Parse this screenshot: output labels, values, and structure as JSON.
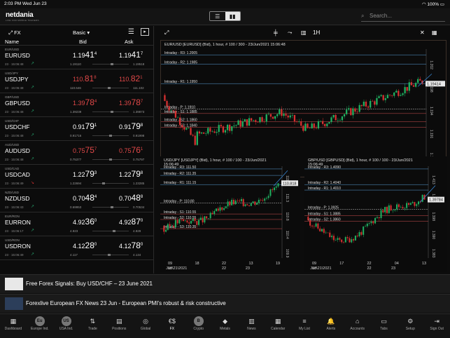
{
  "status": {
    "time": "2:03 PM",
    "date": "Wed Jun 23",
    "battery": "100%"
  },
  "header": {
    "logo": "netdania",
    "logo_sub": "LIVE FOR MOBILE TRADERS",
    "search_placeholder": "Search..."
  },
  "left": {
    "fx": "FX",
    "view": "Basic ▾",
    "cols": {
      "name": "Name",
      "bid": "Bid",
      "ask": "Ask"
    },
    "rows": [
      {
        "code": "EUR/USD",
        "sym": "EURUSD",
        "time": "23 · 15:06:48",
        "bid_a": "1.19",
        "bid_b": "41",
        "bid_c": "4",
        "ask_a": "1.19",
        "ask_b": "41",
        "ask_c": "7",
        "bid_sm": "1.19110",
        "ask_sm": "1.19518",
        "red": false,
        "spark_up": true,
        "pos": 0.55
      },
      {
        "code": "USD/JPY",
        "sym": "USDJPY",
        "time": "23 · 15:06:48",
        "bid_a": "110.",
        "bid_b": "81",
        "bid_c": "8",
        "ask_a": "110.",
        "ask_b": "82",
        "ask_c": "1",
        "bid_sm": "110.646",
        "ask_sm": "111.102",
        "red": true,
        "spark_up": true,
        "pos": 0.45
      },
      {
        "code": "GBP/USD",
        "sym": "GBPUSD",
        "time": "23 · 15:06:48",
        "bid_a": "1.39",
        "bid_b": "78",
        "bid_c": "4",
        "ask_a": "1.39",
        "ask_b": "78",
        "ask_c": "7",
        "bid_sm": "1.39239",
        "ask_sm": "1.39873",
        "red": true,
        "spark_up": true,
        "pos": 0.55
      },
      {
        "code": "USD/CHF",
        "sym": "USDCHF",
        "time": "23 · 15:06:48",
        "bid_a": "0.91",
        "bid_b": "79",
        "bid_c": "1",
        "ask_a": "0.91",
        "ask_b": "79",
        "ask_c": "8",
        "bid_sm": "0.91716",
        "ask_sm": "0.91998",
        "red": false,
        "spark_up": true,
        "pos": 0.5
      },
      {
        "code": "AUD/USD",
        "sym": "AUDUSD",
        "time": "23 · 15:06:48",
        "bid_a": "0.75",
        "bid_b": "75",
        "bid_c": "7",
        "ask_a": "0.75",
        "ask_b": "76",
        "ask_c": "1",
        "bid_sm": "0.75377",
        "ask_sm": "0.75797",
        "red": true,
        "spark_up": true,
        "pos": 0.5
      },
      {
        "code": "USD/CAD",
        "sym": "USDCAD",
        "time": "23 · 15:06:49",
        "bid_a": "1.22",
        "bid_b": "79",
        "bid_c": "3",
        "ask_a": "1.22",
        "ask_b": "79",
        "ask_c": "8",
        "bid_sm": "1.22694",
        "ask_sm": "1.23285",
        "red": false,
        "spark_up": false,
        "pos": 0.3
      },
      {
        "code": "NZD/USD",
        "sym": "NZDUSD",
        "time": "23 · 15:06:43",
        "bid_a": "0.70",
        "bid_b": "48",
        "bid_c": "4",
        "ask_a": "0.70",
        "ask_b": "48",
        "ask_c": "8",
        "bid_sm": "0.69953",
        "ask_sm": "0.70534",
        "red": false,
        "spark_up": true,
        "pos": 0.55
      },
      {
        "code": "EUR/RON",
        "sym": "EURRON",
        "time": "23 · 15:06:17",
        "bid_a": "4.92",
        "bid_b": "36",
        "bid_c": "0",
        "ask_a": "4.92",
        "ask_b": "87",
        "ask_c": "0",
        "bid_sm": "4.923",
        "ask_sm": "4.929",
        "red": false,
        "spark_up": true,
        "pos": 0.6
      },
      {
        "code": "USD/RON",
        "sym": "USDRON",
        "time": "23 · 15:06:49",
        "bid_a": "4.12",
        "bid_b": "28",
        "bid_c": "0",
        "ask_a": "4.12",
        "ask_b": "78",
        "ask_c": "0",
        "bid_sm": "4.117",
        "ask_sm": "4.134",
        "red": false,
        "spark_up": true,
        "pos": 0.45
      }
    ]
  },
  "toolbar": {
    "interval": "1H"
  },
  "charts": {
    "main": {
      "title": "EUR/USD [EURUSD] (Bid), 1 hour, # 100 / 300 - 23/Jun/2021 15:06:48",
      "last": "1.19414",
      "levels": [
        "Intraday - R3: 1.2005",
        "Intraday - R2: 1.1985",
        "Intraday - R1: 1.1950",
        "Intraday - P: 1.1910",
        "Intraday - S1: 1.1885",
        "Intraday - S2: 1.1860",
        "Intraday - S3: 1.1840"
      ],
      "yticks": [
        "1.202",
        "1.198",
        "1.194",
        "1.191",
        "1.187"
      ],
      "xticks": [
        "09",
        "18",
        "21",
        "01",
        "13",
        "21",
        "09",
        "17",
        "22",
        "10",
        "17",
        "00",
        "08"
      ],
      "xdates": [
        "17",
        "Jun\\2021",
        "20",
        "21",
        "22",
        "23",
        "24"
      ]
    },
    "usdjpy": {
      "title": "USD/JPY [USDJPY] (Bid), 1 hour, # 100 / 100 - 23/Jun/2021",
      "title2": "15:06:49",
      "last": "110.818",
      "levels": [
        "Intraday - R3: 111.50",
        "Intraday - R2: 111.35",
        "Intraday - R1: 111.15",
        "Intraday - P: 110.80",
        "Intraday - S1: 110.55",
        "Intraday - S2: 110.55",
        "Intraday - S3: 110.35"
      ],
      "yticks": [
        "111.7",
        "111.3",
        "110.8",
        "110.4",
        "109.9"
      ],
      "xticks": [
        "09",
        "18",
        "22",
        "13",
        "19"
      ],
      "xdates": [
        "18",
        "Jun\\21\\2021",
        "22",
        "23"
      ]
    },
    "gbpusd": {
      "title": "GBP/USD [GBPUSD] (Bid), 1 hour, # 100 / 100 - 23/Jun/2021",
      "title2": "15:06:49",
      "last": "1.39784",
      "levels": [
        "Intraday - R3: 1.4090",
        "Intraday - R2: 1.4040",
        "Intraday - R1: 1.4010",
        "Intraday - P: 1.3925",
        "Intraday - S1: 1.3885",
        "Intraday - S2: 1.3860"
      ],
      "yticks": [
        "1.413",
        "1.405",
        "1.398",
        "1.390",
        "1.383"
      ],
      "xticks": [
        "09",
        "17",
        "22",
        "04",
        "13"
      ],
      "xdates": [
        "18",
        "Jun\\21\\2021",
        "22",
        "23"
      ]
    }
  },
  "news": [
    {
      "text": "Free Forex Signals: Buy USD/CHF – 23 June 2021"
    },
    {
      "text": "Forexlive European FX News 23 Jun - European PMI's robust & risk constructive"
    }
  ],
  "tabs": [
    {
      "label": "Dashboard",
      "icon": "▦"
    },
    {
      "label": "Europe Ind.",
      "icon": "Eu",
      "circ": true
    },
    {
      "label": "USA Ind.",
      "icon": "US",
      "circ": true
    },
    {
      "label": "Trade",
      "icon": "⇅"
    },
    {
      "label": "Positions",
      "icon": "▤"
    },
    {
      "label": "Global",
      "icon": "◎"
    },
    {
      "label": "FX",
      "icon": "€$",
      "active": true
    },
    {
      "label": "Crypto",
      "icon": "B",
      "circ": true
    },
    {
      "label": "Metals",
      "icon": "◆"
    },
    {
      "label": "News",
      "icon": "▥"
    },
    {
      "label": "Calendar",
      "icon": "▦"
    },
    {
      "label": "My List",
      "icon": "≡"
    },
    {
      "label": "Alerts",
      "icon": "🔔"
    },
    {
      "label": "Accounts",
      "icon": "⌂"
    },
    {
      "label": "Tabs",
      "icon": "▭"
    },
    {
      "label": "Setup",
      "icon": "⚙"
    },
    {
      "label": "Sign Out",
      "icon": "⇥"
    }
  ]
}
